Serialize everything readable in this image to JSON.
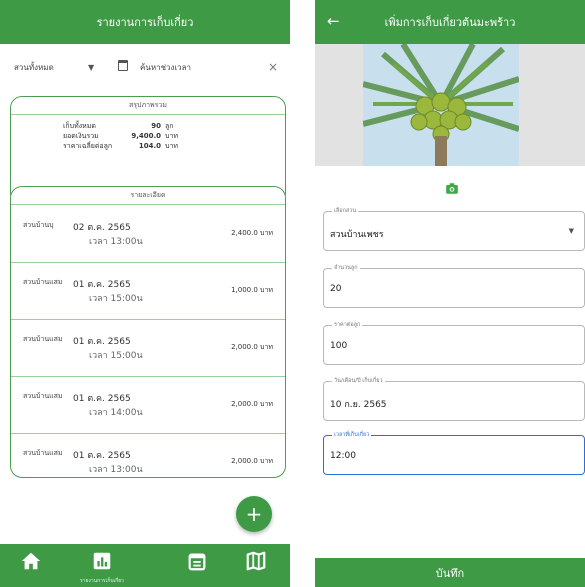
{
  "report": {
    "title": "รายงานการเก็บเกี่ยว",
    "filter": {
      "garden_value": "สวนทั้งหมด",
      "date_placeholder": "ค้นหาช่วงเวลา"
    },
    "summary": {
      "heading": "สรุปภาพรวม",
      "rows": [
        {
          "label": "เก็บทั้งหมด",
          "value": "90",
          "unit": "ลูก"
        },
        {
          "label": "ยอดเงินรวม",
          "value": "9,400.0",
          "unit": "บาท"
        },
        {
          "label": "ราคาเฉลี่ยต่อลูก",
          "value": "104.0",
          "unit": "บาท"
        }
      ]
    },
    "details": {
      "heading": "รายละเอียด",
      "items": [
        {
          "garden": "สวนบ้านบุ",
          "date": "02 ต.ค. 2565",
          "time": "เวลา 13:00น",
          "amount": "2,400.0 บาท"
        },
        {
          "garden": "สวนบ้านแสม",
          "date": "01 ต.ค. 2565",
          "time": "เวลา 15:00น",
          "amount": "1,000.0 บาท"
        },
        {
          "garden": "สวนบ้านแสม",
          "date": "01 ต.ค. 2565",
          "time": "เวลา 15:00น",
          "amount": "2,000.0 บาท"
        },
        {
          "garden": "สวนบ้านแสม",
          "date": "01 ต.ค. 2565",
          "time": "เวลา 14:00น",
          "amount": "2,000.0 บาท"
        },
        {
          "garden": "สวนบ้านแสม",
          "date": "01 ต.ค. 2565",
          "time": "เวลา 13:00น",
          "amount": "2,000.0 บาท"
        }
      ]
    },
    "fab_label": "+",
    "nav": {
      "active_label": "รายงานการเก็บเกี่ยว",
      "icons": [
        "home-icon",
        "chart-icon",
        "calendar-icon",
        "map-icon"
      ]
    }
  },
  "form": {
    "title": "เพิ่มการเก็บเกี่ยวต้นมะพร้าว",
    "back_glyph": "←",
    "fields": [
      {
        "label": "เลือกสวน",
        "value": "สวนบ้านเพชร",
        "dropdown": true
      },
      {
        "label": "จำนวนลูก",
        "value": "20"
      },
      {
        "label": "ราคาต่อลูก",
        "value": "100"
      },
      {
        "label": "วัน/เดือน/ปี เก็บเกี่ยว",
        "value": "10 ก.ย. 2565"
      },
      {
        "label": "เวลาที่เก็บเกี่ยว",
        "value": "12:00",
        "active": true
      }
    ],
    "save_label": "บันทึก"
  },
  "colors": {
    "primary": "#3f9a45",
    "focus": "#2b6fd6"
  }
}
